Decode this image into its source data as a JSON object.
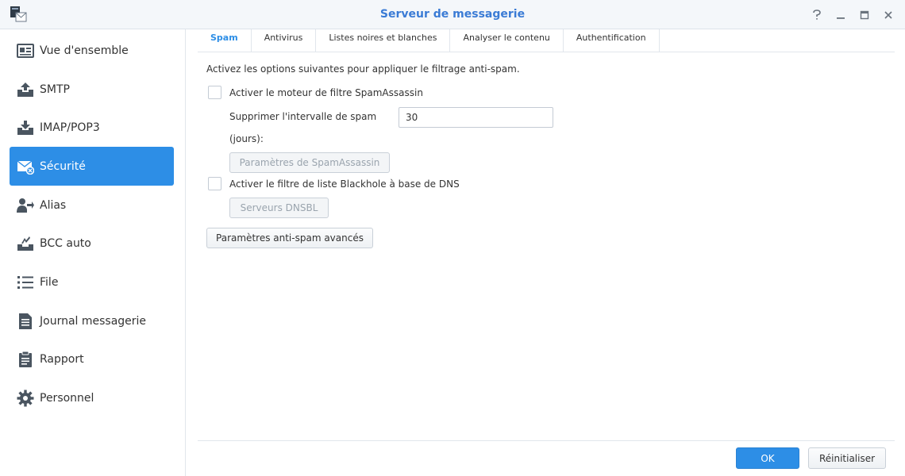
{
  "window": {
    "title": "Serveur de messagerie",
    "controls": [
      "help-icon",
      "minimize-icon",
      "maximize-icon",
      "close-icon"
    ]
  },
  "sidebar": {
    "items": [
      {
        "label": "Vue d'ensemble",
        "icon": "overview-card-icon"
      },
      {
        "label": "SMTP",
        "icon": "outbox-upload-icon"
      },
      {
        "label": "IMAP/POP3",
        "icon": "inbox-download-icon"
      },
      {
        "label": "Sécurité",
        "icon": "envelope-shield-icon",
        "active": true
      },
      {
        "label": "Alias",
        "icon": "user-forward-icon"
      },
      {
        "label": "BCC auto",
        "icon": "bcc-arrow-icon"
      },
      {
        "label": "File",
        "icon": "list-icon"
      },
      {
        "label": "Journal messagerie",
        "icon": "log-document-icon"
      },
      {
        "label": "Rapport",
        "icon": "clipboard-icon"
      },
      {
        "label": "Personnel",
        "icon": "gear-icon"
      }
    ]
  },
  "tabs": [
    {
      "label": "Spam",
      "active": true
    },
    {
      "label": "Antivirus"
    },
    {
      "label": "Listes noires et blanches"
    },
    {
      "label": "Analyser le contenu"
    },
    {
      "label": "Authentification"
    }
  ],
  "spam": {
    "intro": "Activez les options suivantes pour appliquer le filtrage anti-spam.",
    "spamassassin_label": "Activer le moteur de filtre SpamAssassin",
    "delete_interval_label_line1": "Supprimer l'intervalle de spam",
    "delete_interval_label_line2": "(jours):",
    "delete_interval_value": "30",
    "spamassassin_settings_button": "Paramètres de SpamAssassin",
    "dnsbl_label": "Activer le filtre de liste Blackhole à base de DNS",
    "dnsbl_servers_button": "Serveurs DNSBL",
    "advanced_button": "Paramètres anti-spam avancés"
  },
  "footer": {
    "ok_label": "OK",
    "reset_label": "Réinitialiser"
  },
  "colors": {
    "accent": "#2d8ee6",
    "title": "#3a7bd5",
    "icon": "#4a5560"
  }
}
